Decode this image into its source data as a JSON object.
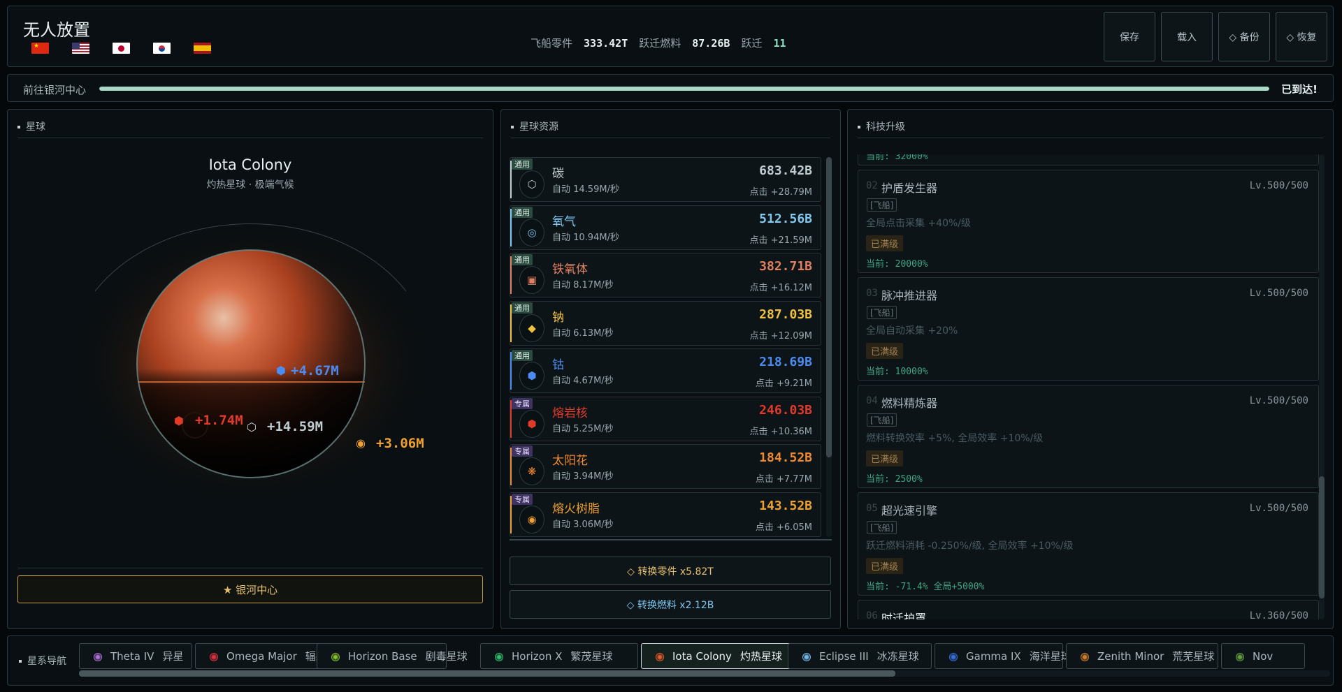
{
  "header": {
    "title": "无人放置",
    "stats": [
      {
        "label": "飞船零件",
        "value": "333.42T"
      },
      {
        "label": "跃迁燃料",
        "value": "87.26B"
      },
      {
        "label": "跃迁",
        "value": "11"
      }
    ],
    "buttons": {
      "save": "保存",
      "load": "载入",
      "backup": "◇ 备份",
      "restore": "◇ 恢复"
    }
  },
  "progress": {
    "label": "前往银河中心",
    "value": 1.0,
    "status": "已到达!"
  },
  "planet_panel": {
    "title": "星球",
    "name": "Iota Colony",
    "subtitle": "灼热星球 · 极端气候",
    "labels": [
      "+4.67M",
      "+1.74M",
      "+14.59M",
      "+3.06M"
    ],
    "galaxy_button": "★ 银河中心",
    "colors": {
      "surface": "#c4492a",
      "hot": "#e06a40",
      "label_blue": "#4c8cf0",
      "label_red": "#e03a2a",
      "label_white": "#c0ccd0",
      "label_orange": "#f0a030"
    }
  },
  "resource_panel": {
    "title": "星球资源",
    "resources": [
      {
        "tag": "通用",
        "icon": "⬡",
        "name": "碳",
        "auto": "自动 14.59M/秒",
        "amount": "683.42B",
        "click": "点击 +28.79M",
        "color": "#c0ccd0",
        "special": false
      },
      {
        "tag": "通用",
        "icon": "◎",
        "name": "氧气",
        "auto": "自动 10.94M/秒",
        "amount": "512.56B",
        "click": "点击 +21.59M",
        "color": "#7fc8f0",
        "special": false
      },
      {
        "tag": "通用",
        "icon": "▣",
        "name": "铁氧体",
        "auto": "自动 8.17M/秒",
        "amount": "382.71B",
        "click": "点击 +16.12M",
        "color": "#e08060",
        "special": false
      },
      {
        "tag": "通用",
        "icon": "◆",
        "name": "钠",
        "auto": "自动 6.13M/秒",
        "amount": "287.03B",
        "click": "点击 +12.09M",
        "color": "#f0c040",
        "special": false
      },
      {
        "tag": "通用",
        "icon": "⬢",
        "name": "钴",
        "auto": "自动 4.67M/秒",
        "amount": "218.69B",
        "click": "点击 +9.21M",
        "color": "#4c8cf0",
        "special": false
      },
      {
        "tag": "专属",
        "icon": "⬢",
        "name": "熔岩核",
        "auto": "自动 5.25M/秒",
        "amount": "246.03B",
        "click": "点击 +10.36M",
        "color": "#e03a2a",
        "special": true
      },
      {
        "tag": "专属",
        "icon": "❋",
        "name": "太阳花",
        "auto": "自动 3.94M/秒",
        "amount": "184.52B",
        "click": "点击 +7.77M",
        "color": "#f08a30",
        "special": true
      },
      {
        "tag": "专属",
        "icon": "◉",
        "name": "熔火树脂",
        "auto": "自动 3.06M/秒",
        "amount": "143.52B",
        "click": "点击 +6.05M",
        "color": "#f0a030",
        "special": true
      }
    ],
    "convert_parts": "◇ 转换零件 x5.82T",
    "convert_fuel": "◇ 转换燃料 x2.12B"
  },
  "tech_panel": {
    "title": "科技升级",
    "top_partial": "当前: 32000%",
    "items": [
      {
        "num": "02",
        "name": "护盾发生器",
        "level": "Lv.500/500",
        "tag": "[飞船]",
        "desc": "全局点击采集 +40%/级",
        "badge": "已满级",
        "current": "当前: 20000%"
      },
      {
        "num": "03",
        "name": "脉冲推进器",
        "level": "Lv.500/500",
        "tag": "[飞船]",
        "desc": "全局自动采集 +20%",
        "badge": "已满级",
        "current": "当前: 10000%"
      },
      {
        "num": "04",
        "name": "燃料精炼器",
        "level": "Lv.500/500",
        "tag": "[飞船]",
        "desc": "燃料转换效率 +5%, 全局效率 +10%/级",
        "badge": "已满级",
        "current": "当前: 2500%"
      },
      {
        "num": "05",
        "name": "超光速引擎",
        "level": "Lv.500/500",
        "tag": "[飞船]",
        "desc": "跃迁燃料消耗 -0.250%/级, 全局效率 +10%/级",
        "badge": "已满级",
        "current": "当前: -71.4% 全局+5000%"
      }
    ],
    "bottom_partial": {
      "num": "06",
      "name": "时迁护罩",
      "level": "Lv.360/500"
    }
  },
  "nav": {
    "label": "星系导航",
    "tabs": [
      {
        "name": "Theta IV",
        "type": "异星",
        "color": "#b070e0",
        "active": false
      },
      {
        "name": "Omega Major",
        "type": "辐射星球",
        "color": "#e03040",
        "active": false
      },
      {
        "name": "Horizon Base",
        "type": "剧毒星球",
        "color": "#80c030",
        "active": false
      },
      {
        "name": "Horizon X",
        "type": "繁茂星球",
        "color": "#30c070",
        "active": false
      },
      {
        "name": "Iota Colony",
        "type": "灼热星球",
        "color": "#e06030",
        "active": true
      },
      {
        "name": "Eclipse III",
        "type": "冰冻星球",
        "color": "#70b8e8",
        "active": false
      },
      {
        "name": "Gamma IX",
        "type": "海洋星球",
        "color": "#3070e0",
        "active": false
      },
      {
        "name": "Zenith Minor",
        "type": "荒芜星球",
        "color": "#d08030",
        "active": false
      },
      {
        "name": "Nov",
        "type": "",
        "color": "#60a040",
        "active": false
      }
    ],
    "scroll": 0.65
  }
}
